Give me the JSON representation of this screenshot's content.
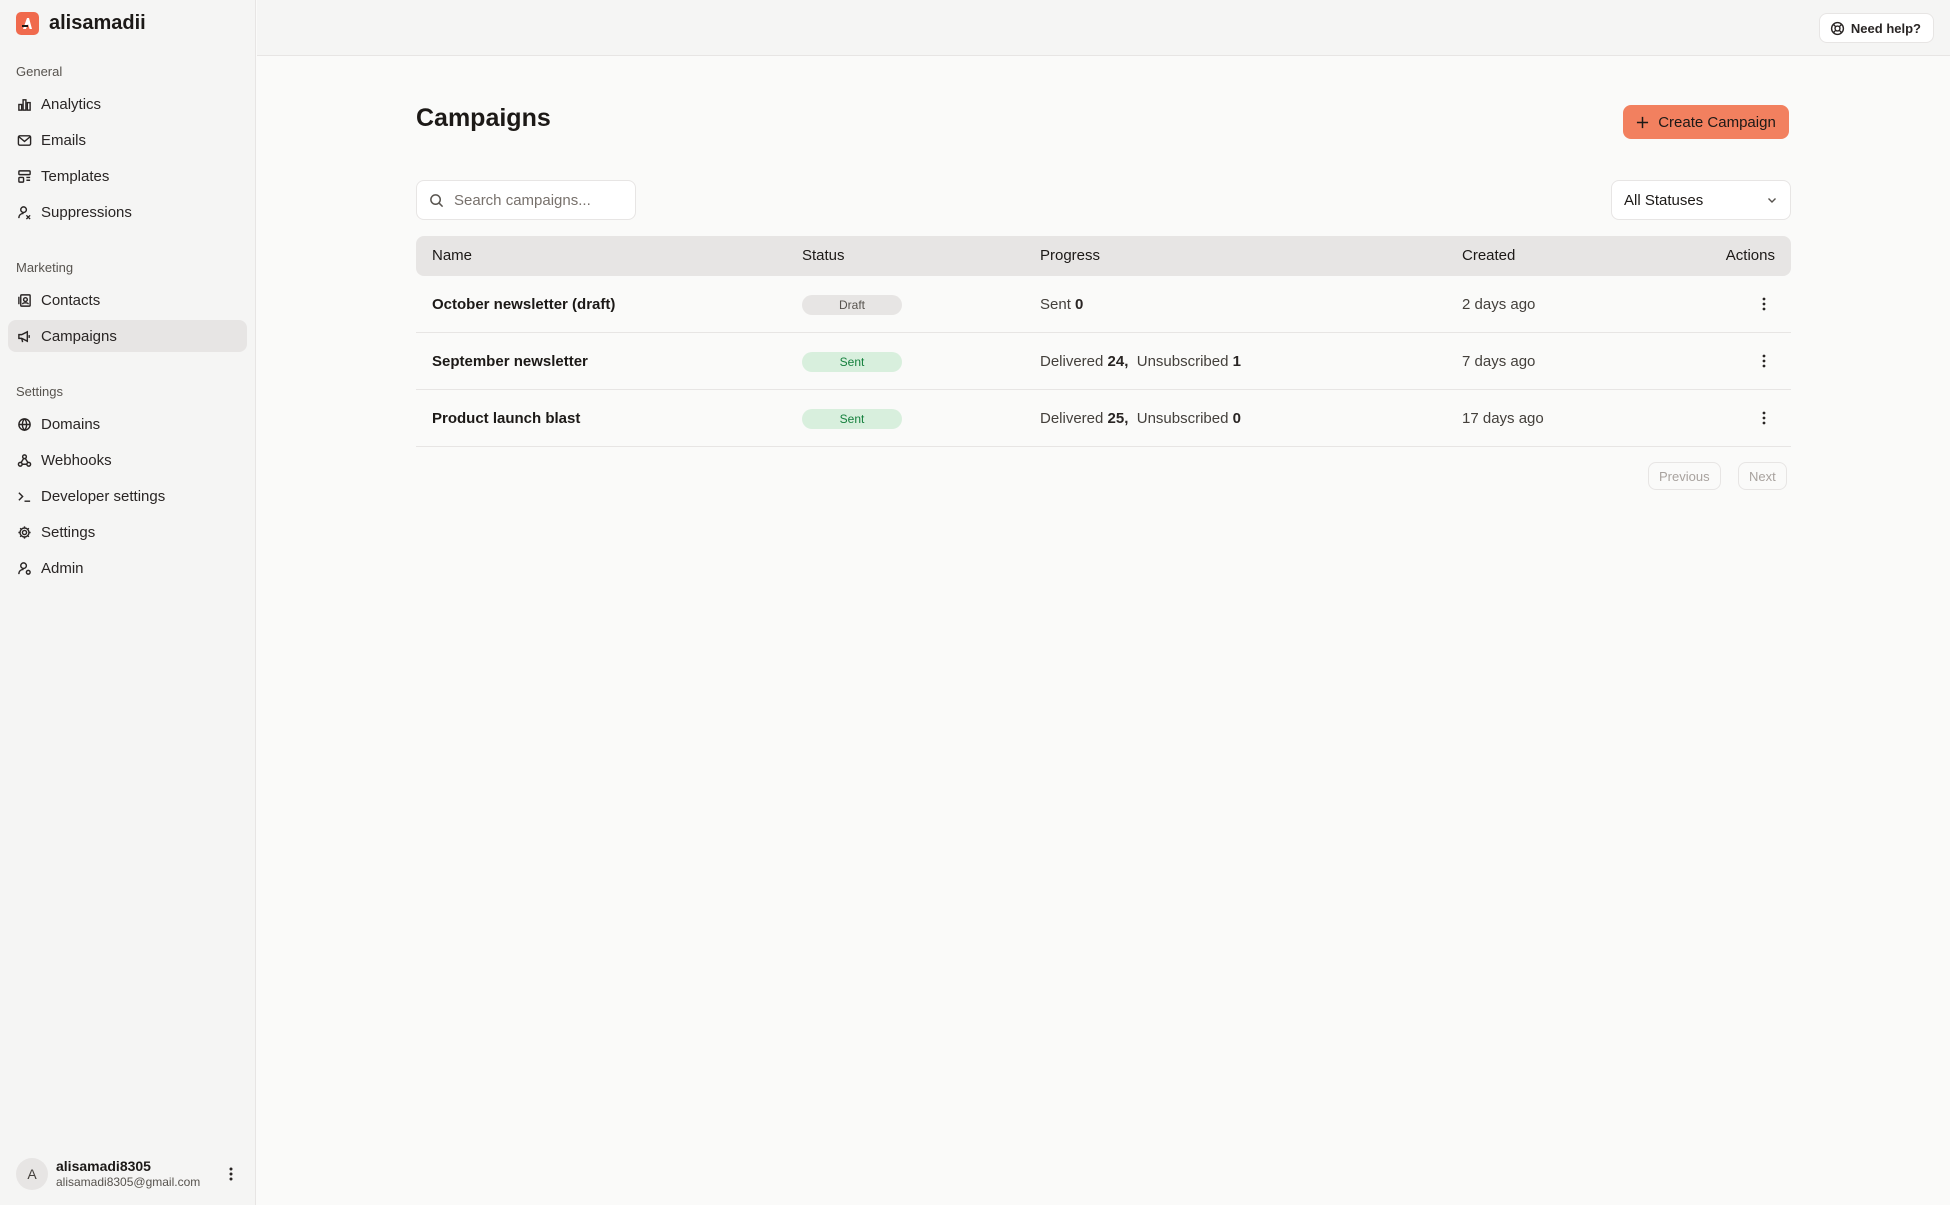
{
  "sidebar": {
    "workspace_name": "alisamadii",
    "sections": [
      {
        "label": "General",
        "items": [
          {
            "label": "Analytics",
            "icon": "bar-chart-icon"
          },
          {
            "label": "Emails",
            "icon": "mail-icon"
          },
          {
            "label": "Templates",
            "icon": "template-icon"
          },
          {
            "label": "Suppressions",
            "icon": "user-blocked-icon"
          }
        ]
      },
      {
        "label": "Marketing",
        "items": [
          {
            "label": "Contacts",
            "icon": "contacts-icon"
          },
          {
            "label": "Campaigns",
            "icon": "megaphone-icon",
            "active": true
          }
        ]
      },
      {
        "label": "Settings",
        "items": [
          {
            "label": "Domains",
            "icon": "globe-icon"
          },
          {
            "label": "Webhooks",
            "icon": "webhook-icon"
          },
          {
            "label": "Developer settings",
            "icon": "terminal-icon"
          },
          {
            "label": "Settings",
            "icon": "gear-icon"
          },
          {
            "label": "Admin",
            "icon": "admin-icon"
          }
        ]
      }
    ],
    "user": {
      "avatar_initial": "A",
      "name": "alisamadi8305",
      "email": "alisamadi8305@gmail.com"
    }
  },
  "topbar": {
    "help_label": "Need help?"
  },
  "main": {
    "title": "Campaigns",
    "create_label": "Create Campaign",
    "search_placeholder": "Search campaigns...",
    "status_filter": "All Statuses",
    "columns": {
      "name": "Name",
      "status": "Status",
      "progress": "Progress",
      "created": "Created",
      "actions": "Actions"
    },
    "rows": [
      {
        "name": "October newsletter (draft)",
        "status": "Draft",
        "progress_a_label": "Sent",
        "progress_a_value": "0",
        "progress_b_label": "",
        "progress_b_value": "",
        "created": "2 days ago"
      },
      {
        "name": "September newsletter",
        "status": "Sent",
        "progress_a_label": "Delivered",
        "progress_a_value": "24,",
        "progress_b_label": "Unsubscribed",
        "progress_b_value": "1",
        "created": "7 days ago"
      },
      {
        "name": "Product launch blast",
        "status": "Sent",
        "progress_a_label": "Delivered",
        "progress_a_value": "25,",
        "progress_b_label": "Unsubscribed",
        "progress_b_value": "0",
        "created": "17 days ago"
      }
    ],
    "pagination": {
      "previous": "Previous",
      "next": "Next"
    }
  },
  "colors": {
    "accent": "#f2805f",
    "brand": "#f06a4d",
    "sent_badge_bg": "#d8efdd",
    "sent_badge_text": "#15803d",
    "draft_badge_bg": "#e7e5e4"
  }
}
